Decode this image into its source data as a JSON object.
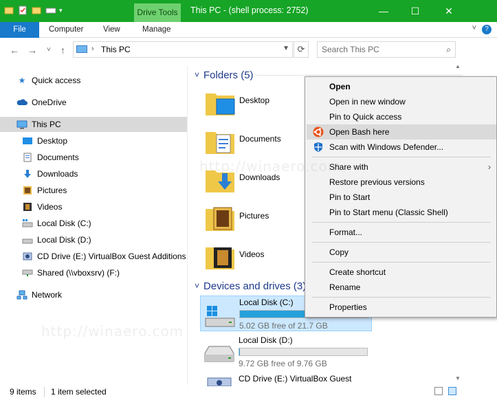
{
  "titlebar": {
    "contextual_tab": "Drive Tools",
    "title": "This PC - (shell process: 2752)",
    "minimize": "—",
    "maximize": "☐",
    "close": "✕"
  },
  "ribbon": {
    "tabs": [
      "File",
      "Computer",
      "View",
      "Manage"
    ],
    "help": "?",
    "collapse": "˅"
  },
  "addressbar": {
    "path": "This PC",
    "crumb_separator": "›",
    "search_placeholder": "Search This PC"
  },
  "nav": {
    "back": "←",
    "forward": "→",
    "recent": "˅",
    "up": "↑",
    "items": [
      {
        "label": "Quick access",
        "icon": "star-icon"
      },
      {
        "label": "OneDrive",
        "icon": "cloud-icon"
      },
      {
        "label": "This PC",
        "icon": "computer-icon"
      },
      {
        "label": "Desktop",
        "icon": "desktop-icon"
      },
      {
        "label": "Documents",
        "icon": "documents-icon"
      },
      {
        "label": "Downloads",
        "icon": "downloads-icon"
      },
      {
        "label": "Pictures",
        "icon": "pictures-icon"
      },
      {
        "label": "Videos",
        "icon": "videos-icon"
      },
      {
        "label": "Local Disk (C:)",
        "icon": "windows-drive-icon"
      },
      {
        "label": "Local Disk (D:)",
        "icon": "drive-icon"
      },
      {
        "label": "CD Drive (E:) VirtualBox Guest Additions",
        "icon": "cd-drive-icon"
      },
      {
        "label": "Shared (\\\\vboxsrv) (F:)",
        "icon": "network-drive-icon"
      },
      {
        "label": "Network",
        "icon": "network-icon"
      }
    ]
  },
  "content": {
    "folders_header": "Folders (5)",
    "folders": [
      "Desktop",
      "Documents",
      "Downloads",
      "Pictures",
      "Videos"
    ],
    "drives_header": "Devices and drives (3)",
    "drives": [
      {
        "name": "Local Disk (C:)",
        "free": "5.02 GB free of 21.7 GB",
        "used_fraction": 0.77
      },
      {
        "name": "Local Disk (D:)",
        "free": "9.72 GB free of 9.76 GB",
        "used_fraction": 0.004
      },
      {
        "name": "CD Drive (E:) VirtualBox Guest"
      }
    ]
  },
  "context_menu": {
    "items": [
      {
        "label": "Open",
        "bold": true
      },
      {
        "label": "Open in new window"
      },
      {
        "label": "Pin to Quick access"
      },
      {
        "label": "Open Bash here",
        "icon": "ubuntu-icon"
      },
      {
        "label": "Scan with Windows Defender...",
        "icon": "defender-shield-icon"
      },
      {
        "label": "Share with",
        "submenu": true
      },
      {
        "label": "Restore previous versions"
      },
      {
        "label": "Pin to Start"
      },
      {
        "label": "Pin to Start menu (Classic Shell)"
      },
      {
        "label": "Format..."
      },
      {
        "label": "Copy"
      },
      {
        "label": "Create shortcut"
      },
      {
        "label": "Rename"
      },
      {
        "label": "Properties"
      }
    ],
    "submenu_arrow": "›"
  },
  "status": {
    "count": "9 items",
    "selection": "1 item selected"
  },
  "watermark": "http://winaero.com",
  "colors": {
    "titlebar": "#16a526",
    "file_tab": "#1979ca",
    "selection": "#cce8ff",
    "drive_fill": "#26a0da",
    "group_header": "#1e3a8a"
  }
}
